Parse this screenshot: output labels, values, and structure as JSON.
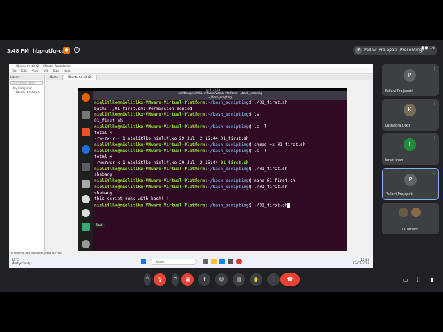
{
  "meet": {
    "time": "3:48 PM",
    "separator": "|",
    "meeting_code": "hbp-utfq-cpp",
    "presenter_badge": "Pallavi Prajapati (Presenting)",
    "presenter_initial": "P",
    "participant_count": "16"
  },
  "vm": {
    "title": "Ubuntu 64-bit (2) - VMware Workstation",
    "menu": [
      "File",
      "Edit",
      "View",
      "VM",
      "Tabs",
      "Help"
    ],
    "library_title": "Library",
    "library_search": "Type here to search",
    "library_items": [
      "My Computer",
      "Ubuntu 64-bit (2)"
    ],
    "tabs": [
      "Home",
      "Ubuntu 64-bit (2)"
    ],
    "status_hint": "To return to your computer, press Ctrl+Alt."
  },
  "ubuntu": {
    "clock": "Jul 2  15:48",
    "term_title": "nielitlko@nielitlko-VMware-Virtual-Platform: ~/bash_scripting",
    "term_subtitle": "~/bash_scripting",
    "dock_tooltip": "Trash",
    "user": "nielitlko@nielitlko-VMware-Virtual-Platform",
    "path": "~/bash_scripting",
    "lines": [
      {
        "prompt": true,
        "cmd": " ./01_first.sh"
      },
      {
        "out": "bash: ./01_first.sh: Permission denied"
      },
      {
        "prompt": true,
        "cmd": " ls"
      },
      {
        "out": "01_first.sh"
      },
      {
        "prompt": true,
        "cmd": " ls -l"
      },
      {
        "out": "total 4"
      },
      {
        "out": "-rw-rw-r-- 1 nielitlko nielitlko 29 Jul  2 15:44 01_first.sh"
      },
      {
        "prompt": true,
        "cmd": " chmod +x 01_first.sh"
      },
      {
        "prompt": true,
        "cmd": " ls -l"
      },
      {
        "out": "total 4"
      },
      {
        "out": "-rwxrwxr-x 1 nielitlko nielitlko 29 Jul  2 15:44 ",
        "green": "01_first.sh"
      },
      {
        "prompt": true,
        "cmd": " ./01_first.sh"
      },
      {
        "out": "shebang"
      },
      {
        "prompt": true,
        "cmd": " nano 01_first.sh"
      },
      {
        "prompt": true,
        "cmd": " ./01_first.sh"
      },
      {
        "out": "shebang"
      },
      {
        "out": "this script runs with bash!!!"
      },
      {
        "prompt": true,
        "cmd": " ./01_first.sh",
        "cursor": true
      }
    ]
  },
  "taskbar": {
    "search": "Search",
    "weather": "33°C",
    "weather_desc": "Mostly cloudy",
    "time": "15:48",
    "date": "02-07-2024"
  },
  "tiles": [
    {
      "name": "Pallavi Prajapati",
      "initial": "P",
      "color": "#5f6368"
    },
    {
      "name": "Kushagra Dixit",
      "initial": "K",
      "color": "#7a6a58"
    },
    {
      "name": "faraz khan",
      "initial": "f",
      "color": "#1e8e3e"
    },
    {
      "name": "Pallavi Prajapati",
      "initial": "P",
      "color": "#5f6368"
    },
    {
      "name": "11 others",
      "initial": "",
      "color": "#3c4043"
    }
  ]
}
